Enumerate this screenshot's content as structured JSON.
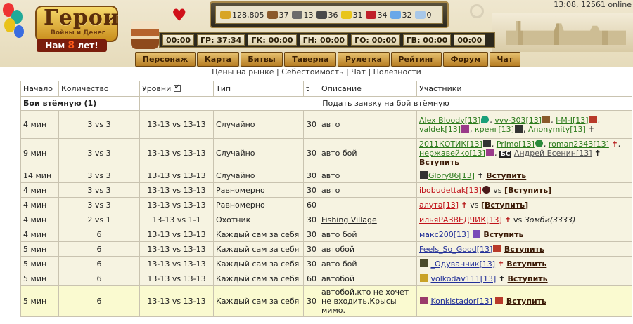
{
  "header": {
    "logo": {
      "title": "Герои",
      "subtitle": "Войны и Денег",
      "years_prefix": "Нам",
      "years_num": "8",
      "years_suffix": "лет!"
    },
    "clock": "13:08, 12561 online",
    "resources": [
      {
        "name": "gold",
        "value": "128,805",
        "color": "#d8a525"
      },
      {
        "name": "wood",
        "value": "37",
        "color": "#8b5a2b"
      },
      {
        "name": "ore",
        "value": "13",
        "color": "#6b6b6b"
      },
      {
        "name": "mercury",
        "value": "36",
        "color": "#4a4a4a"
      },
      {
        "name": "sulfur",
        "value": "31",
        "color": "#e8c51a"
      },
      {
        "name": "crystal",
        "value": "34",
        "color": "#c0202a"
      },
      {
        "name": "gems",
        "value": "32",
        "color": "#6aa8e8"
      },
      {
        "name": "diamonds",
        "value": "0",
        "color": "#a8c8e8"
      }
    ],
    "timers": [
      "00:00",
      "ГР: 37:34",
      "ГК: 00:00",
      "ГН: 00:00",
      "ГО: 00:00",
      "ГВ: 00:00",
      "00:00"
    ],
    "menu": [
      "Персонаж",
      "Карта",
      "Битвы",
      "Таверна",
      "Рулетка",
      "Рейтинг",
      "Форум",
      "Чат"
    ],
    "sublinks": [
      "Цены на рынке",
      "Себестоимость",
      "Чат",
      "Полезности"
    ]
  },
  "table": {
    "columns": [
      "Начало",
      "Количество",
      "Уровни",
      "Тип",
      "t",
      "Описание",
      "Участники"
    ],
    "section_title": "Бои втёмную (1)",
    "section_link": "Подать заявку на бой втёмную",
    "join_label": "Вступить",
    "vs_label": "vs",
    "rows": [
      {
        "start": "4 мин",
        "qty": "3 vs 3",
        "levels": "13-13 vs 13-13",
        "type": "Случайно",
        "t": "30",
        "desc": "авто",
        "p1": "Alex Bloody[13]",
        "p2": "vvv-303[13]",
        "p3": "I-M-I[13]",
        "p4": "valdek[13]",
        "p5": "кренг[13]",
        "p6": "Anonymity[13]"
      },
      {
        "start": "9 мин",
        "qty": "3 vs 3",
        "levels": "13-13 vs 13-13",
        "type": "Случайно",
        "t": "30",
        "desc": "авто бой",
        "p1": "2011КОТИК[13]",
        "p2": "Primo[13]",
        "p3": "roman2343[13]",
        "p4": "нержавейко[13]",
        "bs": "БС",
        "p5": "Андрей Есенин[13]"
      },
      {
        "start": "14 мин",
        "qty": "3 vs 3",
        "levels": "13-13 vs 13-13",
        "type": "Случайно",
        "t": "30",
        "desc": "авто",
        "p1": "Glory86[13]"
      },
      {
        "start": "4 мин",
        "qty": "3 vs 3",
        "levels": "13-13 vs 13-13",
        "type": "Равномерно",
        "t": "30",
        "desc": "авто",
        "p1": "ibobudettak[13]"
      },
      {
        "start": "4 мин",
        "qty": "3 vs 3",
        "levels": "13-13 vs 13-13",
        "type": "Равномерно",
        "t": "60",
        "desc": "",
        "p1": "алута[13]"
      },
      {
        "start": "4 мин",
        "qty": "2 vs 1",
        "levels": "13-13 vs 1-1",
        "type": "Охотник",
        "t": "30",
        "desc": "Fishing Village",
        "p1": "ильяРАЗВЕДЧИК[13]",
        "p2": "Зомби(3333)"
      },
      {
        "start": "4 мин",
        "qty": "6",
        "levels": "13-13 vs 13-13",
        "type": "Каждый сам за себя",
        "t": "30",
        "desc": "авто бой",
        "p1": "макс200[13]"
      },
      {
        "start": "5 мин",
        "qty": "6",
        "levels": "13-13 vs 13-13",
        "type": "Каждый сам за себя",
        "t": "30",
        "desc": "автобой",
        "p1": "Feels_So_Good[13]"
      },
      {
        "start": "5 мин",
        "qty": "6",
        "levels": "13-13 vs 13-13",
        "type": "Каждый сам за себя",
        "t": "30",
        "desc": "авто бой",
        "p1": "_Одуванчик[13]"
      },
      {
        "start": "5 мин",
        "qty": "6",
        "levels": "13-13 vs 13-13",
        "type": "Каждый сам за себя",
        "t": "60",
        "desc": "автобой",
        "p1": "volkodav111[13]"
      },
      {
        "start": "5 мин",
        "qty": "6",
        "levels": "13-13 vs 13-13",
        "type": "Каждый сам за себя",
        "t": "30",
        "desc": "автобой,кто не хочет не входить.Крысы мимо.",
        "p1": "Konkistador[13]"
      }
    ]
  }
}
